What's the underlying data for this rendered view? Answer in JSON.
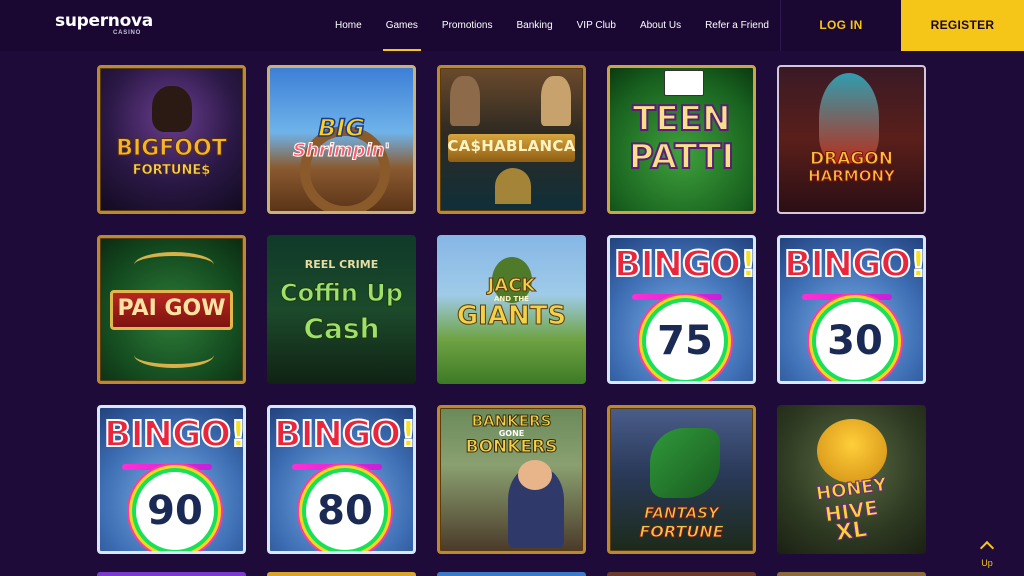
{
  "brand": {
    "name": "supernova",
    "sub": "CASINO"
  },
  "nav": [
    {
      "label": "Home",
      "active": false
    },
    {
      "label": "Games",
      "active": true
    },
    {
      "label": "Promotions",
      "active": false
    },
    {
      "label": "Banking",
      "active": false
    },
    {
      "label": "VIP Club",
      "active": false
    },
    {
      "label": "About Us",
      "active": false
    },
    {
      "label": "Refer a Friend",
      "active": false
    }
  ],
  "auth": {
    "login": "LOG IN",
    "register": "REGISTER"
  },
  "games": [
    {
      "line1": "BIGFOOT",
      "line2": "FORTUNE$"
    },
    {
      "line1": "BIG",
      "line2": "Shrimpin'"
    },
    {
      "line1": "CA$HABLANCA"
    },
    {
      "line1": "TEEN",
      "line2": "PATTI"
    },
    {
      "line1": "DRAGON",
      "line2": "HARMONY"
    },
    {
      "line1": "PAI GOW"
    },
    {
      "line0": "REEL CRIME",
      "line1": "Coffin Up",
      "line2": "Cash"
    },
    {
      "line1": "JACK",
      "line2": "AND THE",
      "line3": "GIANTS"
    },
    {
      "word": "BINGO",
      "bang": "!",
      "number": "75"
    },
    {
      "word": "BINGO",
      "bang": "!",
      "number": "30"
    },
    {
      "word": "BINGO",
      "bang": "!",
      "number": "90"
    },
    {
      "word": "BINGO",
      "bang": "!",
      "number": "80"
    },
    {
      "line1": "BANKERS",
      "line2": "GONE",
      "line3": "BONKERS"
    },
    {
      "line1": "FANTASY",
      "line2": "FORTUNE"
    },
    {
      "line1": "HONEY",
      "line2": "HIVE",
      "line3": "XL"
    }
  ],
  "scroll_up": {
    "label": "Up"
  },
  "colors": {
    "accent": "#f5c518",
    "background": "#1f0b3a",
    "header": "#1a0833"
  }
}
